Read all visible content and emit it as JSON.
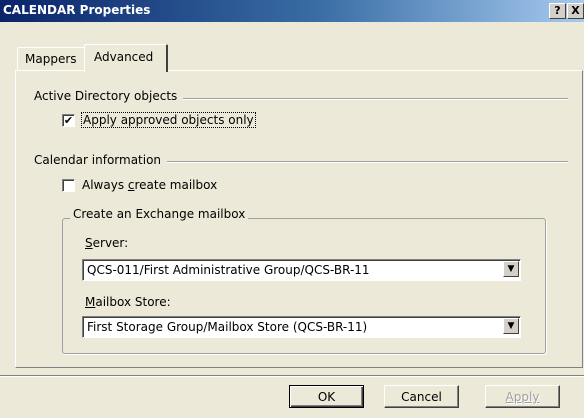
{
  "window": {
    "title": "CALENDAR Properties",
    "help_button": "?",
    "close_button": "X"
  },
  "tabs": [
    {
      "label": "Mappers"
    },
    {
      "label": "Advanced"
    }
  ],
  "active_directory": {
    "section_title": "Active Directory objects",
    "apply_approved": {
      "label": "Apply approved objects only",
      "checked": true
    }
  },
  "calendar_info": {
    "section_title": "Calendar information",
    "always_create": {
      "label_pre": "Always ",
      "label_key": "c",
      "label_post": "reate mailbox",
      "checked": false
    }
  },
  "exchange_group": {
    "title": "Create an Exchange mailbox",
    "server": {
      "label_key": "S",
      "label_post": "erver:",
      "value": "QCS-011/First Administrative Group/QCS-BR-11"
    },
    "mailbox_store": {
      "label_key": "M",
      "label_post": "ailbox Store:",
      "value": "First Storage Group/Mailbox Store (QCS-BR-11)"
    }
  },
  "buttons": {
    "ok": "OK",
    "cancel": "Cancel",
    "apply": "Apply"
  }
}
